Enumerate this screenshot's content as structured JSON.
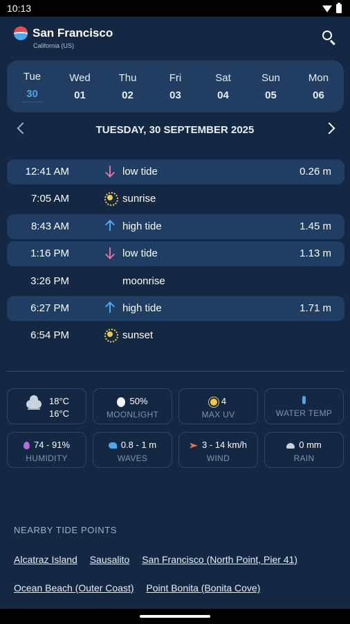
{
  "status_bar": {
    "time": "10:13"
  },
  "header": {
    "city": "San Francisco",
    "region": "California (US)"
  },
  "days": [
    {
      "name": "Tue",
      "date": "30",
      "selected": true
    },
    {
      "name": "Wed",
      "date": "01"
    },
    {
      "name": "Thu",
      "date": "02"
    },
    {
      "name": "Fri",
      "date": "03"
    },
    {
      "name": "Sat",
      "date": "04"
    },
    {
      "name": "Sun",
      "date": "05"
    },
    {
      "name": "Mon",
      "date": "06"
    }
  ],
  "date_title": "TUESDAY, 30 SEPTEMBER 2025",
  "events": [
    {
      "time": "12:41 AM",
      "label": "low tide",
      "height": "0.26 m",
      "icon": "arrow-down-icon"
    },
    {
      "time": "7:05 AM",
      "label": "sunrise",
      "height": "",
      "icon": "sun-icon"
    },
    {
      "time": "8:43 AM",
      "label": "high tide",
      "height": "1.45 m",
      "icon": "arrow-up-icon"
    },
    {
      "time": "1:16 PM",
      "label": "low tide",
      "height": "1.13 m",
      "icon": "arrow-down-icon"
    },
    {
      "time": "3:26 PM",
      "label": "moonrise",
      "height": "",
      "icon": "moon-icon"
    },
    {
      "time": "6:27 PM",
      "label": "high tide",
      "height": "1.71 m",
      "icon": "arrow-up-icon"
    },
    {
      "time": "6:54 PM",
      "label": "sunset",
      "height": "",
      "icon": "sun-icon"
    }
  ],
  "stats": {
    "temp_max": "18°C",
    "temp_min": "16°C",
    "moonlight_value": "50%",
    "moonlight_label": "MOONLIGHT",
    "uv_value": "4",
    "uv_label": "MAX UV",
    "water_temp_label": "WATER TEMP",
    "humidity_value": "74 - 91%",
    "humidity_label": "HUMIDITY",
    "waves_value": "0.8 - 1 m",
    "waves_label": "WAVES",
    "wind_value": "3 - 14 km/h",
    "wind_label": "WIND",
    "rain_value": "0 mm",
    "rain_label": "RAIN"
  },
  "nearby": {
    "title": "NEARBY TIDE POINTS",
    "links": [
      "Alcatraz Island",
      "Sausalito",
      "San Francisco (North Point, Pier 41)",
      "Ocean Beach (Outer Coast)",
      "Point Bonita (Bonita Cove)"
    ]
  },
  "colors": {
    "background": "#142844",
    "panel": "#213d62",
    "accent_blue": "#4aa8e8",
    "low_tide_pink": "#e46fa3",
    "sun_yellow": "#f2c94c"
  }
}
